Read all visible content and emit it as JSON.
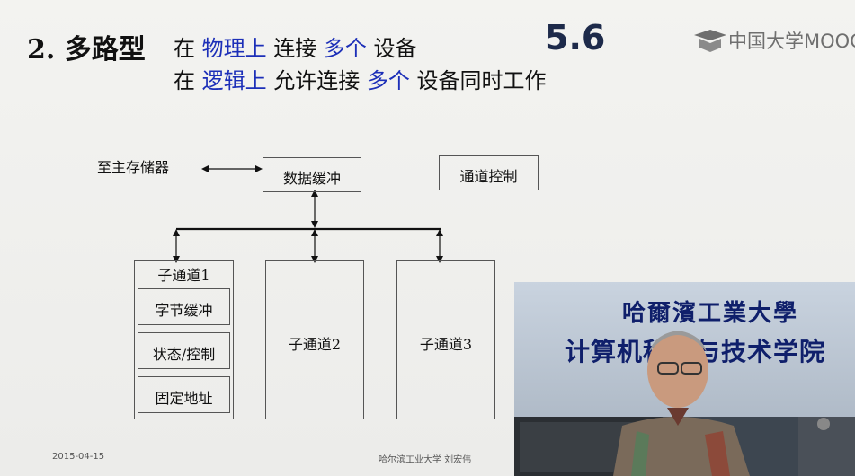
{
  "slide": {
    "title": "2. 多路型",
    "line1": [
      "在 ",
      "物理上",
      " 连接 ",
      "多个",
      " 设备"
    ],
    "line2": [
      "在 ",
      "逻辑上",
      " 允许连接 ",
      "多个",
      " 设备同时工作"
    ],
    "section_number": "5.6",
    "logo_text": "中国大学MOOC",
    "colors": {
      "highlight": "#1c2fb8"
    }
  },
  "diagram": {
    "main_memory_label": "至主存储器",
    "data_buffer_label": "数据缓冲",
    "channel_control_label": "通道控制",
    "subchannel1": {
      "title": "子通道1",
      "items": [
        "字节缓冲",
        "状态/控制",
        "固定地址"
      ]
    },
    "subchannel2": "子通道2",
    "subchannel3": "子通道3"
  },
  "footer": {
    "date": "2015-04-15",
    "author": "哈尔滨工业大学  刘宏伟"
  },
  "video": {
    "wall_text_1": "哈爾濱工業大學",
    "wall_text_2": "计算机科学与技术学院"
  }
}
